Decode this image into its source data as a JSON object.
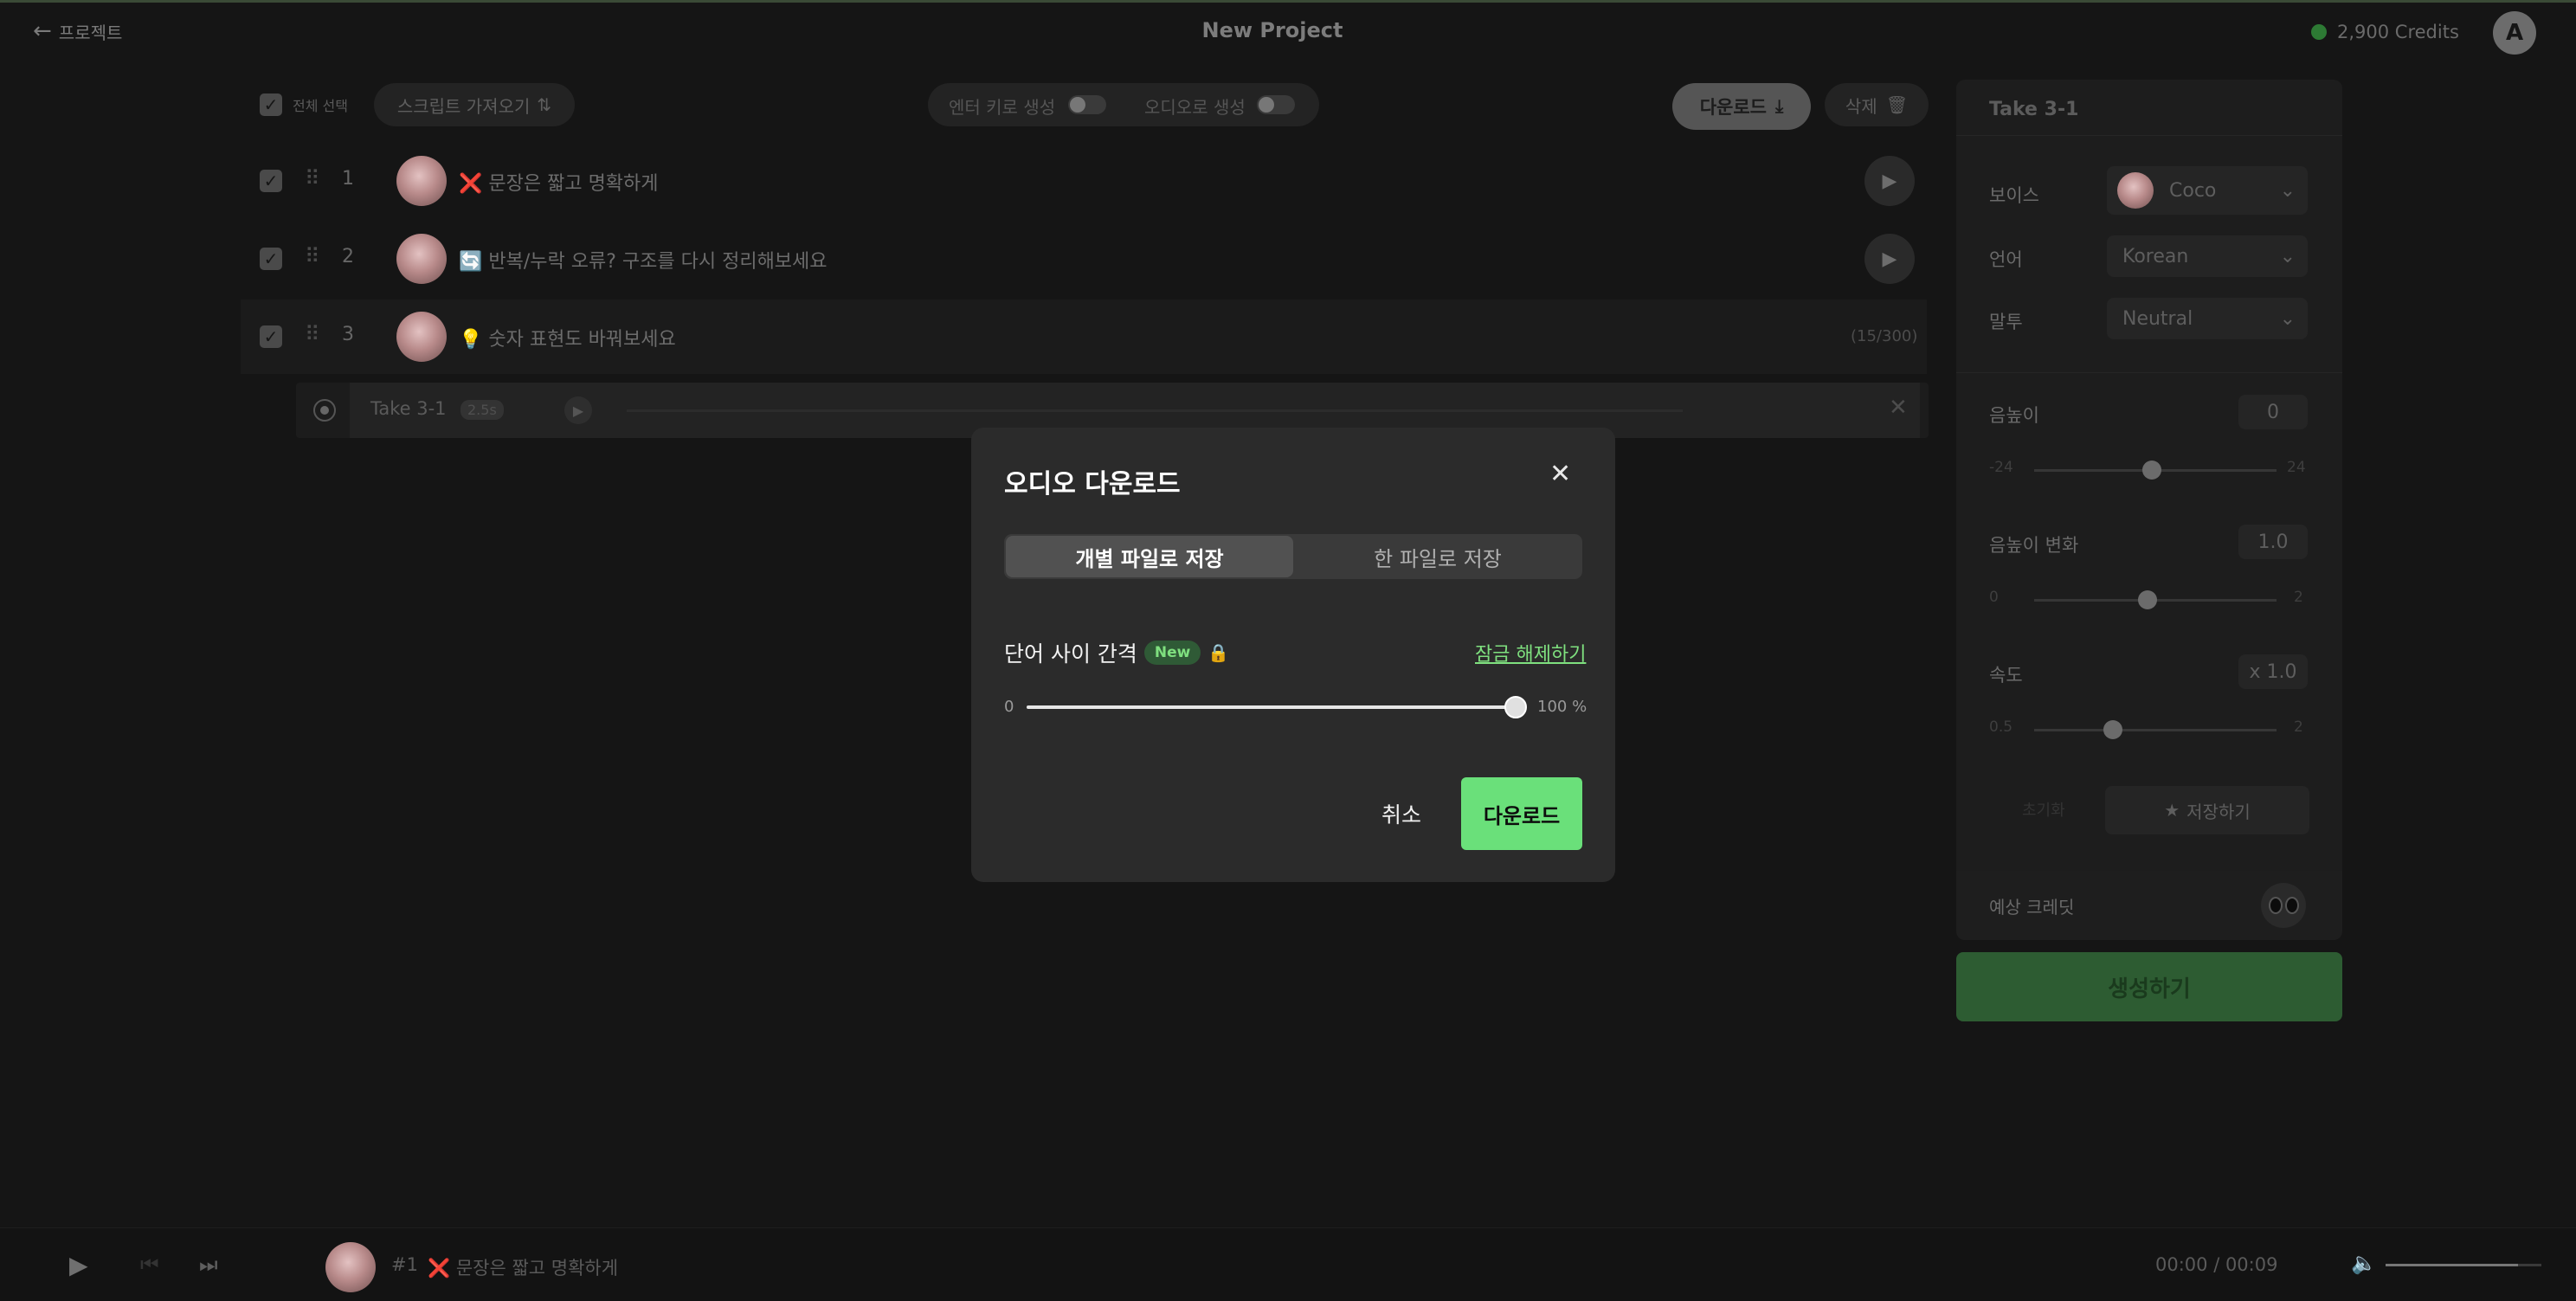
{
  "header": {
    "back_label": "프로젝트",
    "project_title": "New Project",
    "credits": "2,900 Credits",
    "avatar_initial": "A"
  },
  "toolbar": {
    "select_all_label": "전체 선택",
    "import_script_label": "스크립트 가져오기",
    "enter_generate_label": "엔터 키로 생성",
    "audio_generate_label": "오디오로 생성",
    "download_label": "다운로드",
    "delete_label": "삭제"
  },
  "script_rows": [
    {
      "index": "1",
      "text": "❌ 문장은 짧고 명확하게"
    },
    {
      "index": "2",
      "text": "🔄 반복/누락 오류? 구조를 다시 정리해보세요"
    },
    {
      "index": "3",
      "text": "💡 숫자 표현도 바꿔보세요",
      "count": "(15/300)"
    }
  ],
  "take_row": {
    "label": "Take 3-1",
    "duration": "2.5s"
  },
  "side_panel": {
    "title": "Take 3-1",
    "voice_label": "보이스",
    "voice_value": "Coco",
    "language_label": "언어",
    "language_value": "Korean",
    "tone_label": "말투",
    "tone_value": "Neutral",
    "pitch_label": "음높이",
    "pitch_value": "0",
    "pitch_min": "-24",
    "pitch_max": "24",
    "pitch_variation_label": "음높이 변화",
    "pitch_variation_value": "1.0",
    "pitch_variation_min": "0",
    "pitch_variation_max": "2",
    "speed_label": "속도",
    "speed_value": "x 1.0",
    "speed_min": "0.5",
    "speed_max": "2",
    "reset_label": "초기화",
    "save_label": "저장하기",
    "estimated_credit_label": "예상 크레딧",
    "generate_label": "생성하기"
  },
  "player": {
    "track_index": "#1",
    "track_text": "❌ 문장은 짧고 명확하게",
    "time": "00:00 / 00:09",
    "volume_level": 0.85
  },
  "modal": {
    "title": "오디오 다운로드",
    "tab_individual": "개별 파일로 저장",
    "tab_single": "한 파일로 저장",
    "word_gap_label": "단어 사이 간격",
    "new_badge": "New",
    "unlock_link": "잠금 해제하기",
    "slider_min": "0",
    "slider_max": "100 %",
    "slider_value": 100,
    "cancel_label": "취소",
    "download_label": "다운로드"
  },
  "colors": {
    "accent_green": "#6ae07a",
    "background": "#151515",
    "modal_bg": "#2b2b2b"
  }
}
